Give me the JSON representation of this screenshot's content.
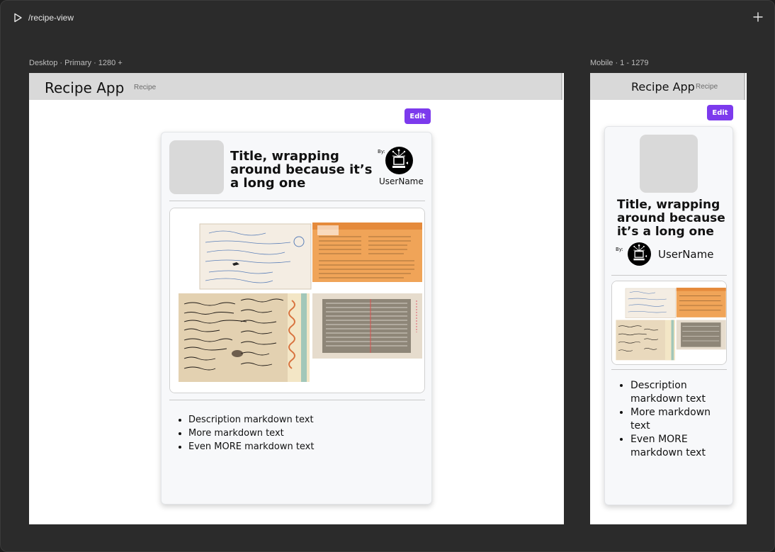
{
  "topbar": {
    "route": "/recipe-view",
    "play_icon": "play-icon",
    "add_icon": "plus-icon"
  },
  "desktop": {
    "frame_label": "Desktop · Primary · 1280 +",
    "app_title": "Recipe App",
    "tab_label": "Recipe",
    "edit_label": "Edit",
    "recipe_title": "Title, wrapping around because it’s a long one",
    "by_label": "By:",
    "username": "UserName",
    "description": [
      "Description markdown text",
      "More markdown text",
      "Even MORE markdown text"
    ]
  },
  "mobile": {
    "frame_label": "Mobile · 1 - 1279",
    "app_title": "Recipe App",
    "tab_label": "Recipe",
    "edit_label": "Edit",
    "recipe_title": "Title, wrapping around because it’s a long one",
    "by_label": "By:",
    "username": "UserName",
    "description": [
      "Description markdown text",
      "More markdown text",
      "Even MORE markdown text"
    ]
  },
  "colors": {
    "canvas": "#2b2b2b",
    "header_bg": "#d9d9d9",
    "accent": "#7c3aed",
    "card_bg": "#f7f8fa"
  }
}
